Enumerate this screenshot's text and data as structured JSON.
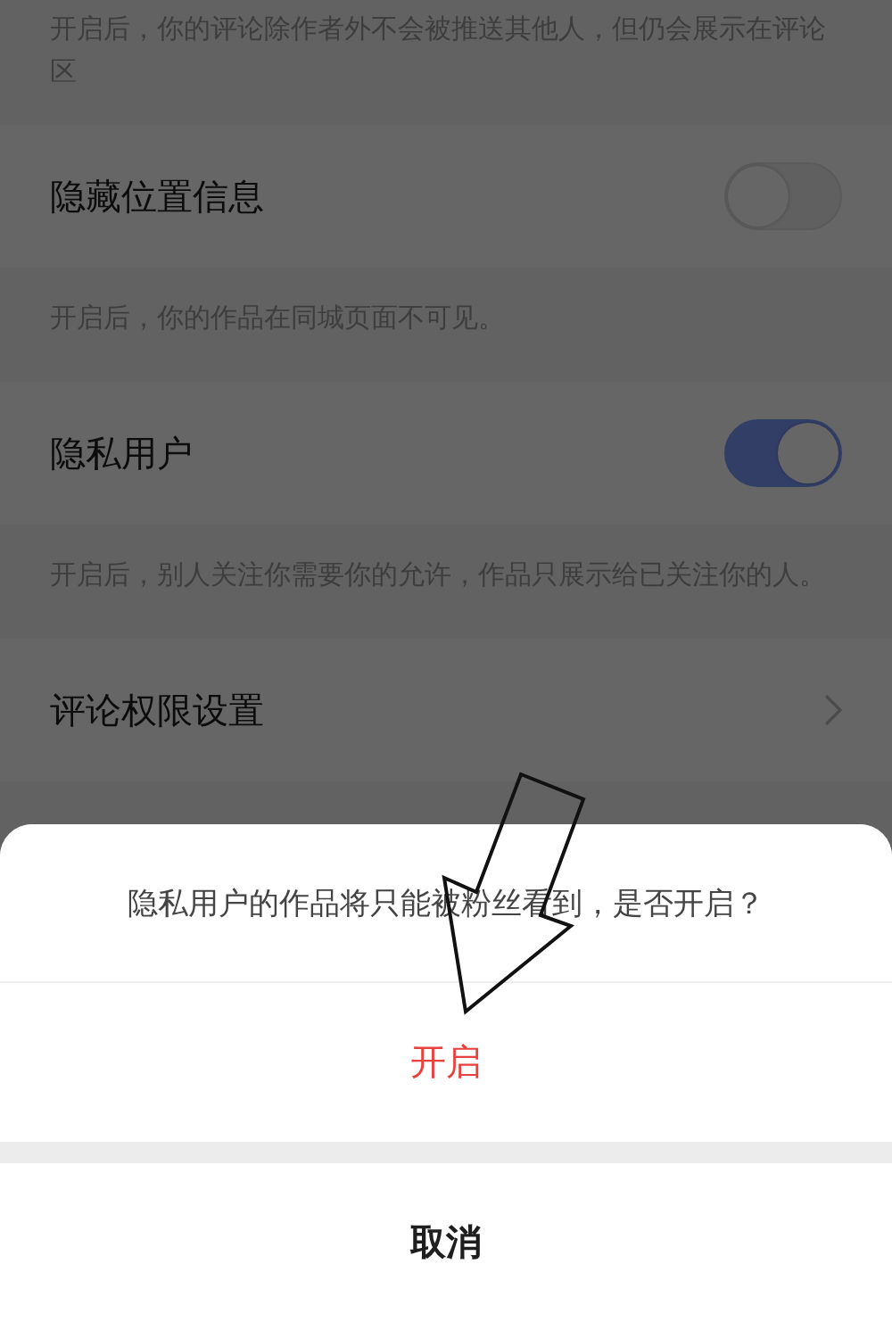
{
  "settings": [
    {
      "kind": "note",
      "text": "开启后，你的评论除作者外不会被推送其他人，但仍会展示在评论区"
    },
    {
      "kind": "toggle",
      "label": "隐藏位置信息",
      "on": false
    },
    {
      "kind": "note",
      "text": "开启后，你的作品在同城页面不可见。"
    },
    {
      "kind": "toggle",
      "label": "隐私用户",
      "on": true
    },
    {
      "kind": "note",
      "text": "开启后，别人关注你需要你的允许，作品只展示给已关注你的人。"
    },
    {
      "kind": "link",
      "label": "评论权限设置"
    }
  ],
  "action_sheet": {
    "message": "隐私用户的作品将只能被粉丝看到，是否开启？",
    "actions": [
      {
        "label": "开启",
        "kind": "confirm"
      },
      {
        "label": "取消",
        "kind": "cancel"
      }
    ]
  }
}
